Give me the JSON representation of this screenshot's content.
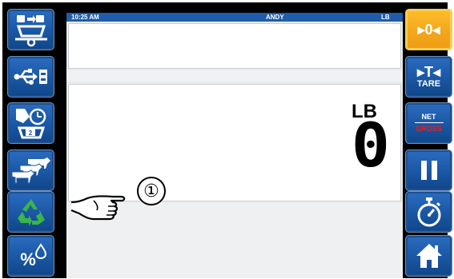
{
  "status_bar": {
    "time": "10:25 AM",
    "user": "ANDY",
    "unit": "LB"
  },
  "display": {
    "unit": "LB",
    "weight": "0"
  },
  "left_buttons": [
    {
      "icon": "ration-mixer-icon"
    },
    {
      "icon": "usb-transfer-icon"
    },
    {
      "icon": "load-timer-icon"
    },
    {
      "icon": "cattle-herd-icon"
    },
    {
      "icon": "recycle-icon"
    },
    {
      "icon": "percent-moisture-icon"
    }
  ],
  "right_buttons": {
    "zero": "▸0◂",
    "tare_symbol": "▸T◂",
    "tare": "TARE",
    "net": "NET",
    "gross": "GROSS"
  },
  "annotation": {
    "callout": "①"
  },
  "colors": {
    "button_blue": "#1d5aa9",
    "button_orange": "#f3a71c",
    "recycle_green": "#39b54a",
    "status_bar": "#1f5cab",
    "gross_red": "#e02020"
  }
}
